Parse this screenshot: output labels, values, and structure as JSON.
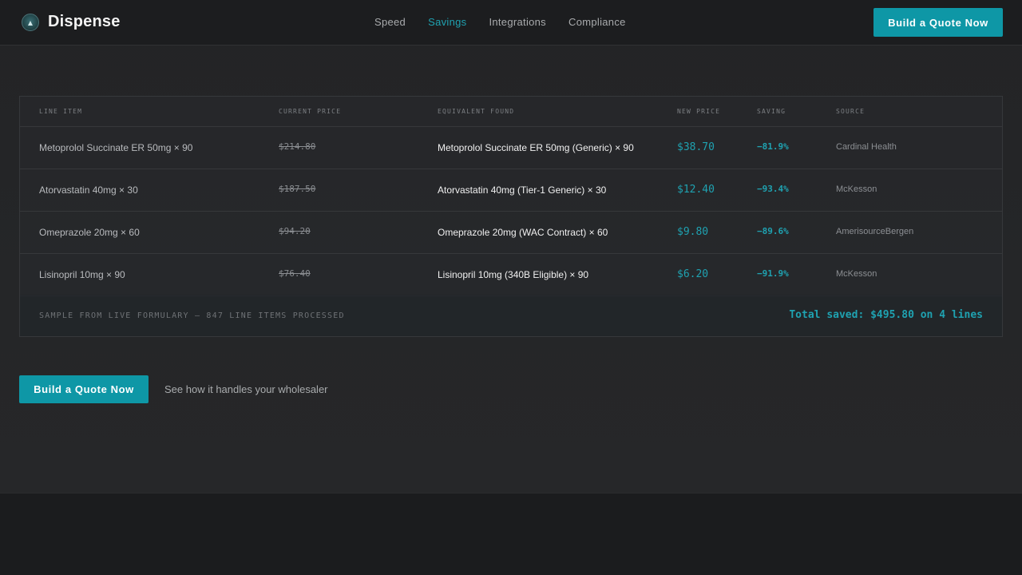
{
  "header": {
    "brand": "Dispense",
    "nav": [
      {
        "label": "Speed",
        "active": false
      },
      {
        "label": "Savings",
        "active": true
      },
      {
        "label": "Integrations",
        "active": false
      },
      {
        "label": "Compliance",
        "active": false
      }
    ],
    "cta_label": "Build a Quote Now"
  },
  "table": {
    "columns": [
      "LINE ITEM",
      "CURRENT PRICE",
      "EQUIVALENT FOUND",
      "NEW PRICE",
      "SAVING",
      "SOURCE"
    ],
    "rows": [
      {
        "item": "Metoprolol Succinate ER 50mg × 90",
        "current": "$214.80",
        "equivalent": "Metoprolol Succinate ER 50mg (Generic) × 90",
        "new_price": "$38.70",
        "saving": "−81.9%",
        "source": "Cardinal Health"
      },
      {
        "item": "Atorvastatin 40mg × 30",
        "current": "$187.50",
        "equivalent": "Atorvastatin 40mg (Tier-1 Generic) × 30",
        "new_price": "$12.40",
        "saving": "−93.4%",
        "source": "McKesson"
      },
      {
        "item": "Omeprazole 20mg × 60",
        "current": "$94.20",
        "equivalent": "Omeprazole 20mg (WAC Contract) × 60",
        "new_price": "$9.80",
        "saving": "−89.6%",
        "source": "AmerisourceBergen"
      },
      {
        "item": "Lisinopril 10mg × 90",
        "current": "$76.40",
        "equivalent": "Lisinopril 10mg (340B Eligible) × 90",
        "new_price": "$6.20",
        "saving": "−91.9%",
        "source": "McKesson"
      }
    ],
    "footer_note": "SAMPLE FROM LIVE FORMULARY — 847 LINE ITEMS PROCESSED",
    "footer_total": "Total saved: $495.80 on 4 lines"
  },
  "cta": {
    "button_label": "Build a Quote Now",
    "link_text": "See how it handles your wholesaler"
  },
  "colors": {
    "accent": "#0e97a6",
    "accent_text": "#1fa2b1",
    "background": "#1b1c1e"
  }
}
